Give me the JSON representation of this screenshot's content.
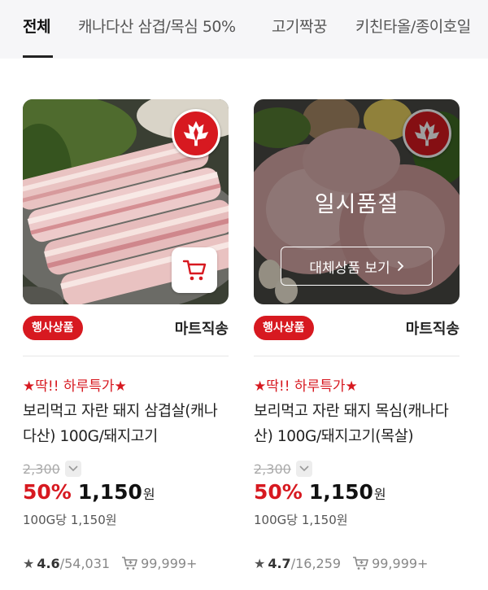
{
  "tabs": [
    {
      "label": "전체",
      "active": true
    },
    {
      "label": "캐나다산 삼겹/목심 50%"
    },
    {
      "label": "고기짝꿍"
    },
    {
      "label": "키친타올/종이호일"
    }
  ],
  "colors": {
    "accent": "#d71920"
  },
  "products": [
    {
      "promo": "★딱!! 하루특가★",
      "title": "보리먹고 자란 돼지 삼겹살(캐나다산) 100G/돼지고기",
      "event_badge": "행사상품",
      "delivery": "마트직송",
      "original_price": "2,300",
      "discount": "50%",
      "price": "1,150",
      "currency": "원",
      "unit_price": "100G당 1,150원",
      "rating": "4.6",
      "reviews": "/54,031",
      "cart_count": "99,999+",
      "sold_out": false,
      "image": "pork-belly-photo"
    },
    {
      "promo": "★딱!! 하루특가★",
      "title": "보리먹고 자란 돼지 목심(캐나다산) 100G/돼지고기(목살)",
      "event_badge": "행사상품",
      "delivery": "마트직송",
      "original_price": "2,300",
      "discount": "50%",
      "price": "1,150",
      "currency": "원",
      "unit_price": "100G당 1,150원",
      "rating": "4.7",
      "reviews": "/16,259",
      "cart_count": "99,999+",
      "sold_out": true,
      "soldout_label": "일시품절",
      "replace_label": "대체상품 보기",
      "image": "pork-neck-photo"
    }
  ],
  "icons": [
    "maple-leaf-icon",
    "cart-icon",
    "chevron-down-icon",
    "chevron-right-icon",
    "star-icon",
    "cart-plus-icon"
  ]
}
